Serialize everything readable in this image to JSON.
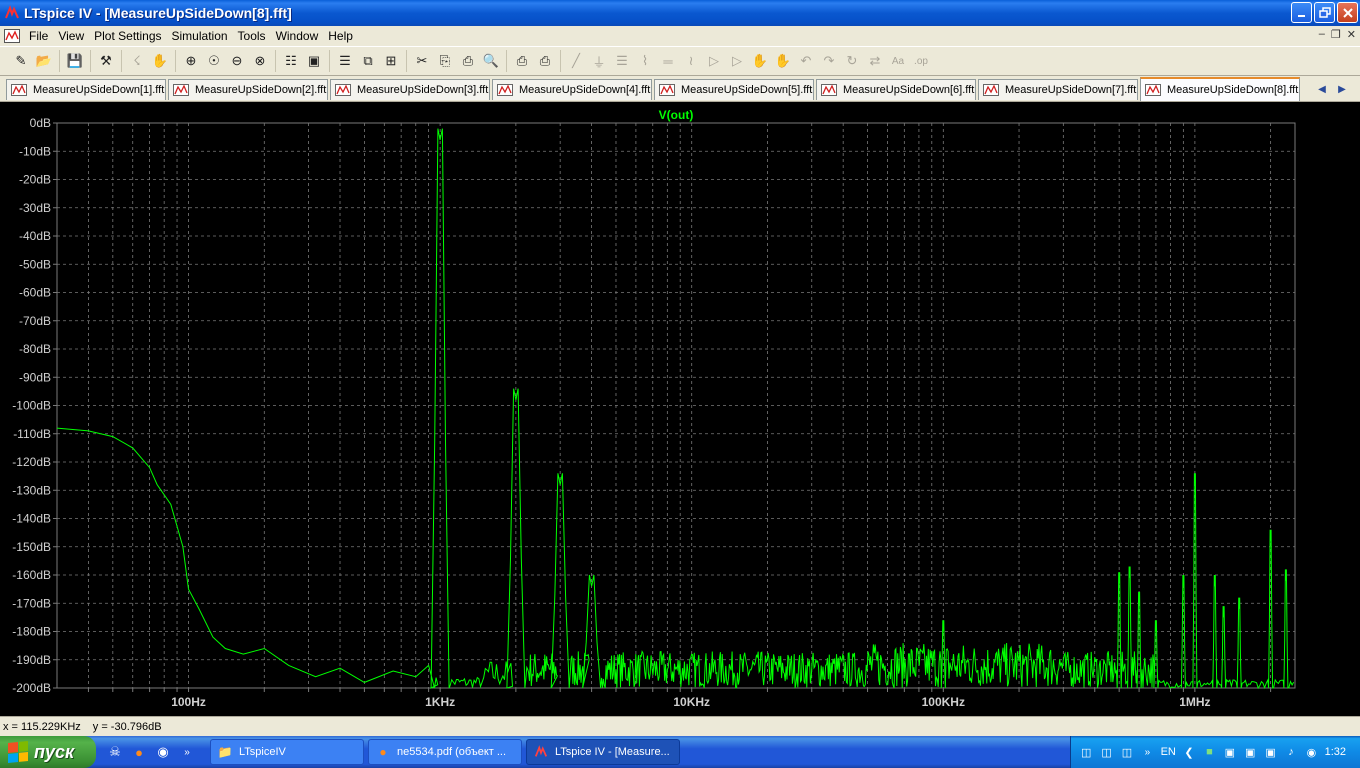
{
  "window": {
    "title": "LTspice IV - [MeasureUpSideDown[8].fft]"
  },
  "menu": [
    "File",
    "View",
    "Plot Settings",
    "Simulation",
    "Tools",
    "Window",
    "Help"
  ],
  "toolbar": [
    {
      "group": [
        "schematic-icon",
        "open-icon"
      ]
    },
    {
      "group": [
        "save-icon"
      ]
    },
    {
      "group": [
        "control-panel-icon"
      ]
    },
    {
      "group": [
        "run-icon",
        "halt-icon"
      ]
    },
    {
      "group": [
        "zoom-in-icon",
        "zoom-area-icon",
        "zoom-out-icon",
        "zoom-cancel-icon"
      ]
    },
    {
      "group": [
        "autorange-icon",
        "zoom-fit-icon"
      ]
    },
    {
      "group": [
        "tile-horizontal-icon",
        "cascade-icon",
        "tile-icon"
      ]
    },
    {
      "group": [
        "cut-icon",
        "copy-icon",
        "paste-icon",
        "find-icon"
      ]
    },
    {
      "group": [
        "print-setup-icon",
        "print-icon"
      ]
    },
    {
      "group": [
        "wire-icon",
        "ground-icon",
        "label-icon",
        "resistor-icon",
        "capacitor-icon",
        "inductor-icon",
        "diode-icon",
        "component-icon",
        "move-icon",
        "drag-icon",
        "undo-icon",
        "redo-icon",
        "rotate-icon",
        "mirror-icon",
        "text-icon",
        "spice-directive-icon"
      ]
    }
  ],
  "tabs": [
    "MeasureUpSideDown[1].fft",
    "MeasureUpSideDown[2].fft",
    "MeasureUpSideDown[3].fft",
    "MeasureUpSideDown[4].fft",
    "MeasureUpSideDown[5].fft",
    "MeasureUpSideDown[6].fft",
    "MeasureUpSideDown[7].fft",
    "MeasureUpSideDown[8].fft"
  ],
  "active_tab": 7,
  "colors": {
    "trace": "#00ff00",
    "background": "#000000",
    "grid": "#7a7a7a",
    "axis_text": "#d0d0d0"
  },
  "chart_data": {
    "type": "line",
    "title": "V(out)",
    "xscale": "log",
    "xlim": [
      30,
      2500000
    ],
    "ylim": [
      -200,
      0
    ],
    "xticks": [
      {
        "value": 100,
        "label": "100Hz"
      },
      {
        "value": 1000,
        "label": "1KHz"
      },
      {
        "value": 10000,
        "label": "10KHz"
      },
      {
        "value": 100000,
        "label": "100KHz"
      },
      {
        "value": 1000000,
        "label": "1MHz"
      }
    ],
    "yticks": [
      {
        "value": 0,
        "label": "0dB"
      },
      {
        "value": -10,
        "label": "-10dB"
      },
      {
        "value": -20,
        "label": "-20dB"
      },
      {
        "value": -30,
        "label": "-30dB"
      },
      {
        "value": -40,
        "label": "-40dB"
      },
      {
        "value": -50,
        "label": "-50dB"
      },
      {
        "value": -60,
        "label": "-60dB"
      },
      {
        "value": -70,
        "label": "-70dB"
      },
      {
        "value": -80,
        "label": "-80dB"
      },
      {
        "value": -90,
        "label": "-90dB"
      },
      {
        "value": -100,
        "label": "-100dB"
      },
      {
        "value": -110,
        "label": "-110dB"
      },
      {
        "value": -120,
        "label": "-120dB"
      },
      {
        "value": -130,
        "label": "-130dB"
      },
      {
        "value": -140,
        "label": "-140dB"
      },
      {
        "value": -150,
        "label": "-150dB"
      },
      {
        "value": -160,
        "label": "-160dB"
      },
      {
        "value": -170,
        "label": "-170dB"
      },
      {
        "value": -180,
        "label": "-180dB"
      },
      {
        "value": -190,
        "label": "-190dB"
      },
      {
        "value": -200,
        "label": "-200dB"
      }
    ],
    "grid": true,
    "series": [
      {
        "name": "V(out)",
        "baseline": [
          [
            30,
            -108
          ],
          [
            40,
            -109
          ],
          [
            50,
            -111
          ],
          [
            60,
            -115
          ],
          [
            70,
            -122
          ],
          [
            75,
            -128
          ],
          [
            85,
            -135
          ],
          [
            95,
            -150
          ],
          [
            100,
            -165
          ],
          [
            110,
            -172
          ],
          [
            125,
            -182
          ],
          [
            140,
            -186
          ],
          [
            165,
            -188
          ],
          [
            200,
            -186
          ],
          [
            250,
            -192
          ],
          [
            320,
            -196
          ],
          [
            400,
            -193
          ],
          [
            500,
            -198
          ],
          [
            650,
            -194
          ],
          [
            800,
            -196
          ],
          [
            900,
            -192
          ]
        ],
        "peaks": [
          {
            "f": 1000,
            "db": -6
          },
          {
            "f": 2000,
            "db": -98
          },
          {
            "f": 3000,
            "db": -128
          },
          {
            "f": 4000,
            "db": -164
          },
          {
            "f": 100000,
            "db": -180
          },
          {
            "f": 500000,
            "db": -163
          },
          {
            "f": 550000,
            "db": -161
          },
          {
            "f": 600000,
            "db": -170
          },
          {
            "f": 700000,
            "db": -180
          },
          {
            "f": 900000,
            "db": -164
          },
          {
            "f": 1000000,
            "db": -128
          },
          {
            "f": 1200000,
            "db": -164
          },
          {
            "f": 1300000,
            "db": -175
          },
          {
            "f": 1500000,
            "db": -172
          },
          {
            "f": 2000000,
            "db": -148
          },
          {
            "f": 2300000,
            "db": -162
          }
        ],
        "noise_floor": {
          "from": 2000,
          "to": 700000,
          "min": -200,
          "max": -187
        }
      }
    ]
  },
  "status": {
    "x": "x = 115.229KHz",
    "y": "y = -30.796dB"
  },
  "taskbar": {
    "start_label": "пуск",
    "tasks": [
      {
        "label": "LTspiceIV",
        "icon": "folder-icon"
      },
      {
        "label": "ne5534.pdf (объект ...",
        "icon": "firefox-icon"
      },
      {
        "label": "LTspice IV - [Measure...",
        "icon": "ltspice-icon"
      }
    ],
    "lang": "EN",
    "clock": "1:32"
  }
}
